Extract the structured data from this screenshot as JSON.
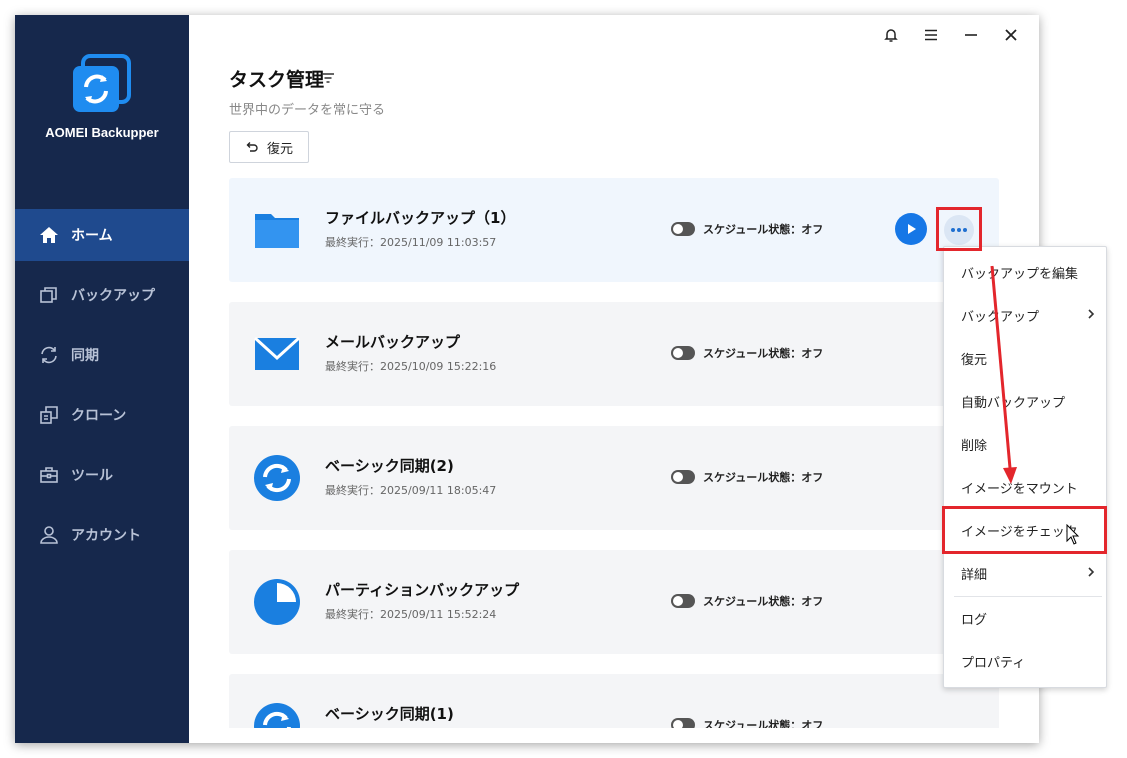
{
  "app": {
    "name": "AOMEI Backupper"
  },
  "sidebar": {
    "items": [
      {
        "label": "ホーム",
        "icon": "home-icon",
        "active": true
      },
      {
        "label": "バックアップ",
        "icon": "backup-icon"
      },
      {
        "label": "同期",
        "icon": "sync-icon"
      },
      {
        "label": "クローン",
        "icon": "clone-icon"
      },
      {
        "label": "ツール",
        "icon": "tools-icon"
      },
      {
        "label": "アカウント",
        "icon": "account-icon"
      }
    ]
  },
  "titlebar": {
    "icons": [
      "bell-icon",
      "menu-icon",
      "minimize-icon",
      "close-icon"
    ]
  },
  "page": {
    "title": "タスク管理",
    "subtitle": "世界中のデータを常に守る",
    "restore_label": "復元"
  },
  "tasks": [
    {
      "name": "ファイルバックアップ（1）",
      "last_run": "最終実行：2025/11/09 11:03:57",
      "schedule": "スケジュール状態：オフ",
      "icon": "folder-icon"
    },
    {
      "name": "メールバックアップ",
      "last_run": "最終実行：2025/10/09 15:22:16",
      "schedule": "スケジュール状態：オフ",
      "icon": "mail-icon"
    },
    {
      "name": "ベーシック同期(2)",
      "last_run": "最終実行：2025/09/11 18:05:47",
      "schedule": "スケジュール状態：オフ",
      "icon": "sync-circle-icon"
    },
    {
      "name": "パーティションバックアップ",
      "last_run": "最終実行：2025/09/11 15:52:24",
      "schedule": "スケジュール状態：オフ",
      "icon": "partition-icon"
    },
    {
      "name": "ベーシック同期(1)",
      "last_run": "",
      "schedule": "スケジュール状態：オフ",
      "icon": "sync-circle-icon"
    }
  ],
  "context_menu": {
    "items": [
      {
        "label": "バックアップを編集"
      },
      {
        "label": "バックアップ",
        "submenu": true
      },
      {
        "label": "復元"
      },
      {
        "label": "自動バックアップ"
      },
      {
        "label": "削除"
      },
      {
        "label": "イメージをマウント"
      },
      {
        "label": "イメージをチェック",
        "highlighted": true
      },
      {
        "label": "詳細",
        "submenu": true
      },
      {
        "label": "ログ"
      },
      {
        "label": "プロパティ"
      }
    ]
  },
  "colors": {
    "sidebar_bg": "#16284c",
    "sidebar_active": "#1f4a8e",
    "accent": "#1677e6",
    "annotation_red": "#e3262c"
  }
}
